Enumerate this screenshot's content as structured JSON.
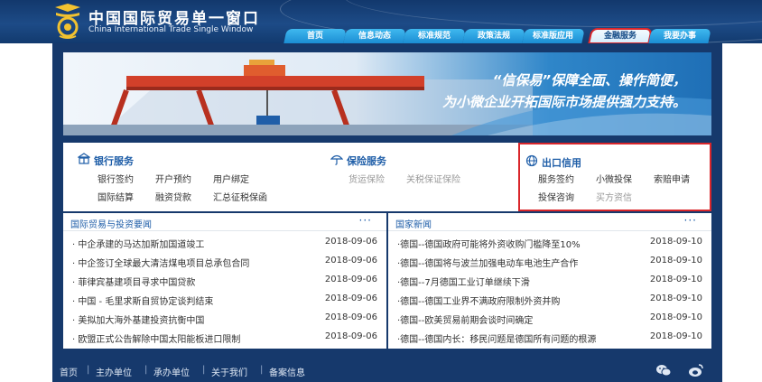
{
  "site": {
    "title": "中国国际贸易单一窗口",
    "subtitle": "China International Trade Single Window"
  },
  "nav": {
    "tabs": [
      {
        "label": "首页"
      },
      {
        "label": "信息动态"
      },
      {
        "label": "标准规范"
      },
      {
        "label": "政策法规"
      },
      {
        "label": "标准版应用"
      },
      {
        "label": "金融服务",
        "highlighted": true
      },
      {
        "label": "我要办事"
      }
    ]
  },
  "banner": {
    "line1": "“信保易”保障全面、操作简便，",
    "line2": "为小微企业开拓国际市场提供强力支持。"
  },
  "services": {
    "bank": {
      "title": "银行服务",
      "icon": "bank-icon",
      "links": [
        "银行签约",
        "开户预约",
        "用户绑定",
        "国际结算",
        "融资贷款",
        "汇总征税保函"
      ]
    },
    "insurance": {
      "title": "保险服务",
      "icon": "umbrella-icon",
      "links": [
        "货运保险",
        "关税保证保险"
      ]
    },
    "export_credit": {
      "title": "出口信用",
      "icon": "globe-icon",
      "links": [
        "服务签约",
        "小微投保",
        "索赔申请",
        "投保咨询",
        "买方资信"
      ]
    }
  },
  "news_left": {
    "title": "国际贸易与投资要闻",
    "more": "···",
    "items": [
      {
        "text": "· 中企承建的马达加斯加国道竣工",
        "date": "2018-09-06"
      },
      {
        "text": "· 中企签订全球最大清洁煤电项目总承包合同",
        "date": "2018-09-06"
      },
      {
        "text": "· 菲律宾基建项目寻求中国贷款",
        "date": "2018-09-06"
      },
      {
        "text": "· 中国 - 毛里求斯自贸协定谈判结束",
        "date": "2018-09-06"
      },
      {
        "text": "· 美拟加大海外基建投资抗衡中国",
        "date": "2018-09-06"
      },
      {
        "text": "· 欧盟正式公告解除中国太阳能板进口限制",
        "date": "2018-09-06"
      }
    ]
  },
  "news_right": {
    "title": "国家新闻",
    "more": "···",
    "items": [
      {
        "text": "·德国--德国政府可能将外资收购门槛降至10%",
        "date": "2018-09-10"
      },
      {
        "text": "·德国--德国将与波兰加强电动车电池生产合作",
        "date": "2018-09-10"
      },
      {
        "text": "·德国--7月德国工业订单继续下滑",
        "date": "2018-09-10"
      },
      {
        "text": "·德国--德国工业界不满政府限制外资并购",
        "date": "2018-09-10"
      },
      {
        "text": "·德国--欧美贸易前期会谈时间确定",
        "date": "2018-09-10"
      },
      {
        "text": "·德国--德国内长：移民问题是德国所有问题的根源",
        "date": "2018-09-10"
      }
    ]
  },
  "footer": {
    "links": [
      "首页",
      "主办单位",
      "承办单位",
      "关于我们",
      "备案信息"
    ],
    "separator": "|",
    "icons": [
      "wechat-icon",
      "weibo-icon"
    ]
  },
  "colors": {
    "header_bg": "#1d4b87",
    "tab_blue": "#1b8dd3",
    "highlight_border": "#d9262b",
    "link_blue": "#1f5ea8"
  }
}
